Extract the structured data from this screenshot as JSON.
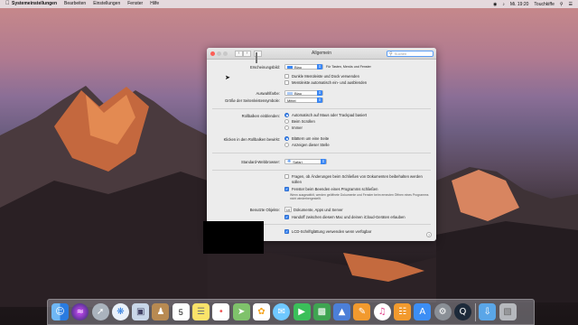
{
  "menubar": {
    "app_name": "Systemeinstellungen",
    "items": [
      "Bearbeiten",
      "Einstellungen",
      "Fenster",
      "Hilfe"
    ],
    "clock": "Mi. 19:20",
    "right_label": "Touchkiffe"
  },
  "window": {
    "title": "Allgemein",
    "search_placeholder": "Suchen"
  },
  "settings": {
    "appearance_label": "Erscheinungsbild:",
    "appearance_value": "Blau",
    "appearance_note": "Für Tasten, Menüs und Fenster",
    "dark_menu_label": "Dunkle Menüleiste und Dock verwenden",
    "dark_menu_checked": false,
    "auto_hide_label": "Menüleiste automatisch ein- und ausblenden",
    "auto_hide_checked": false,
    "highlight_label": "Auswahlfarbe:",
    "highlight_value": "Blau",
    "sidebar_icon_label": "Größe der Seitenleistensymbole:",
    "sidebar_icon_value": "Mittel",
    "scrollbars_label": "Rollbalken einblenden:",
    "scrollbars_options": [
      "Automatisch auf Maus oder Trackpad basiert",
      "Beim Scrollen",
      "Immer"
    ],
    "scrollbars_selected": 0,
    "click_label": "Klicken in den Rollbalken bewirkt:",
    "click_options": [
      "Blättern um eine Seite",
      "Anzeigen dieser Stelle"
    ],
    "click_selected": 0,
    "browser_label": "Standard-Webbrowser:",
    "browser_value": "Safari",
    "ask_changes_label": "Fragen, ob Änderungen beim Schließen von Dokumenten beibehalten werden sollen",
    "ask_changes_checked": false,
    "close_windows_label": "Fenster beim Beenden eines Programms schließen",
    "close_windows_checked": true,
    "close_windows_note": "Wenn ausgewählt, werden geöffnete Dokumente und Fenster beim erneuten Öffnen eines Programms nicht wiederhergestellt.",
    "recent_label": "Benutzte Objekte:",
    "recent_value": "10",
    "recent_suffix": "Dokumente, Apps und Server",
    "handoff_label": "Handoff zwischen diesem Mac und deinen iCloud-Geräten erlauben",
    "handoff_checked": true,
    "lcd_label": "LCD-Schriftglättung verwenden wenn verfügbar",
    "lcd_checked": true,
    "help_symbol": "?"
  },
  "dock": {
    "icons": [
      "finder-icon",
      "siri-icon",
      "launchpad-icon",
      "safari-icon",
      "photo-preview-icon",
      "contacts-icon",
      "calendar-icon",
      "notes-icon",
      "reminders-icon",
      "maps-icon",
      "photos-icon",
      "messages-icon",
      "facetime-icon",
      "numbers-icon",
      "keynote-icon",
      "pages-icon",
      "itunes-icon",
      "ibooks-icon",
      "app-store-icon",
      "system-preferences-icon",
      "quicktime-icon",
      "downloads-folder-icon",
      "trash-icon"
    ],
    "calendar_day": "5"
  },
  "colors": {
    "accent": "#3b87f3",
    "close": "#fc5f57",
    "minimize": "#c8c8c8",
    "zoom": "#c8c8c8"
  }
}
